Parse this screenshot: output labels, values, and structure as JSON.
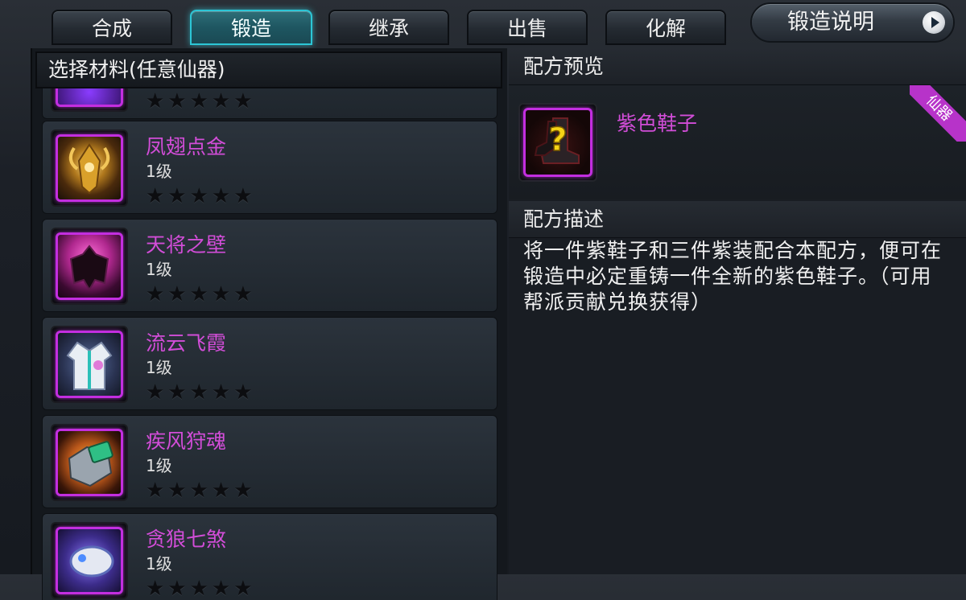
{
  "tabs": [
    {
      "label": "合成",
      "active": false
    },
    {
      "label": "锻造",
      "active": true
    },
    {
      "label": "继承",
      "active": false
    },
    {
      "label": "出售",
      "active": false
    },
    {
      "label": "化解",
      "active": false
    }
  ],
  "info_button": {
    "label": "锻造说明",
    "icon": "play-icon"
  },
  "left_panel": {
    "title": "选择材料(任意仙器)",
    "items": [
      {
        "name": "",
        "level": "",
        "stars": "★★★★★",
        "icon": "partial-item-icon"
      },
      {
        "name": "凤翅点金",
        "level": "1级",
        "stars": "★★★★★",
        "icon": "golden-helmet-icon"
      },
      {
        "name": "天将之壁",
        "level": "1级",
        "stars": "★★★★★",
        "icon": "armor-silhouette-icon"
      },
      {
        "name": "流云飞霞",
        "level": "1级",
        "stars": "★★★★★",
        "icon": "robe-icon"
      },
      {
        "name": "疾风狩魂",
        "level": "1级",
        "stars": "★★★★★",
        "icon": "green-shoulder-armor-icon"
      },
      {
        "name": "贪狼七煞",
        "level": "1级",
        "stars": "★★★★★",
        "icon": "bracer-icon"
      }
    ]
  },
  "right_panel": {
    "preview_title": "配方预览",
    "preview_item": {
      "name": "紫色鞋子",
      "icon": "mystery-boots-icon",
      "badge": "仙器"
    },
    "desc_title": "配方描述",
    "description": "将一件紫鞋子和三件紫装配合本配方，便可在锻造中必定重铸一件全新的紫色鞋子。（可用帮派贡献兑换获得）"
  },
  "colors": {
    "accent_tab": "#2cc6d6",
    "item_name_purple": "#d24dd8",
    "icon_border_purple": "#c32ee0",
    "badge_purple": "#b733c9"
  }
}
